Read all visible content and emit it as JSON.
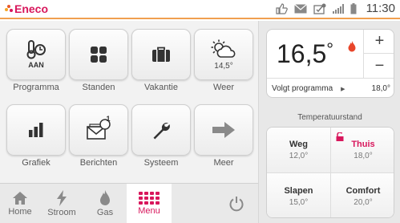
{
  "topbar": {
    "brand": "Eneco",
    "time": "11:30",
    "icons": [
      "thumbs-up-icon",
      "mail-icon",
      "checklist-icon",
      "signal-icon",
      "battery-icon"
    ]
  },
  "tiles": [
    {
      "id": "programma",
      "label": "Programma",
      "icon": "thermometer-clock-icon",
      "badge": "AAN"
    },
    {
      "id": "standen",
      "label": "Standen",
      "icon": "grid-icon"
    },
    {
      "id": "vakantie",
      "label": "Vakantie",
      "icon": "suitcase-icon"
    },
    {
      "id": "weer",
      "label": "Weer",
      "icon": "sun-cloud-icon",
      "value": "14,5°"
    },
    {
      "id": "grafiek",
      "label": "Grafiek",
      "icon": "bar-chart-icon"
    },
    {
      "id": "berichten",
      "label": "Berichten",
      "icon": "messages-icon",
      "count": "1"
    },
    {
      "id": "systeem",
      "label": "Systeem",
      "icon": "wrench-icon"
    },
    {
      "id": "meer",
      "label": "Meer",
      "icon": "arrow-right-icon"
    }
  ],
  "bottomnav": {
    "items": [
      {
        "label": "Home",
        "icon": "house-icon"
      },
      {
        "label": "Stroom",
        "icon": "lightning-icon"
      },
      {
        "label": "Gas",
        "icon": "flame-icon"
      },
      {
        "label": "Menu",
        "icon": "menu-grid-icon",
        "active": true
      }
    ],
    "power_icon": "power-icon"
  },
  "thermostat": {
    "current_temp": "16,5",
    "degree": "°",
    "plus": "+",
    "minus": "−",
    "program_label": "Volgt programma",
    "program_value": "18,0°"
  },
  "temperatuurstand": {
    "title": "Temperatuurstand",
    "presets": [
      {
        "name": "Weg",
        "value": "12,0°"
      },
      {
        "name": "Thuis",
        "value": "18,0°",
        "active": true
      },
      {
        "name": "Slapen",
        "value": "15,0°"
      },
      {
        "name": "Comfort",
        "value": "20,0°"
      }
    ]
  },
  "colors": {
    "accent": "#d8175c",
    "topbar_line": "#f0a050",
    "flame": "#e8452a"
  }
}
